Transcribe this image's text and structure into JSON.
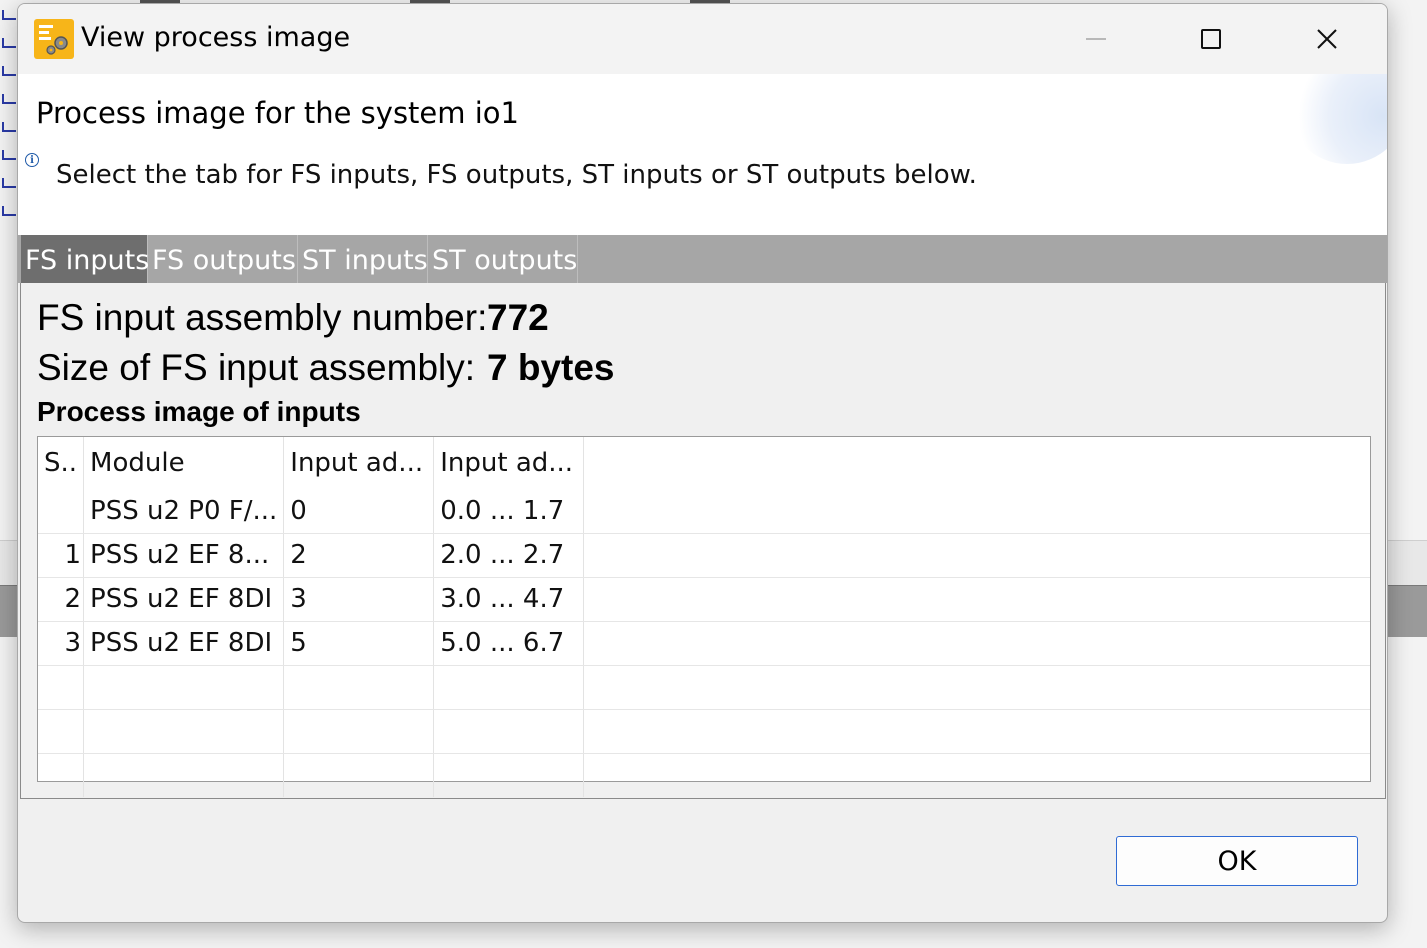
{
  "window": {
    "title": "View process image",
    "icon": "gear-app-icon",
    "controls": [
      "minimize-icon",
      "maximize-icon",
      "close-icon"
    ]
  },
  "header": {
    "title": "Process image for the system io1",
    "message": "Select the tab for FS inputs, FS outputs, ST inputs or ST outputs below.",
    "info_icon": "info-icon"
  },
  "tabs": [
    {
      "label": "FS inputs",
      "active": true
    },
    {
      "label": "FS outputs",
      "active": false
    },
    {
      "label": "ST inputs",
      "active": false
    },
    {
      "label": "ST outputs",
      "active": false
    }
  ],
  "content": {
    "assembly_number_label": "FS input assembly number:",
    "assembly_number_value": "772",
    "assembly_size_label": "Size of FS input assembly:",
    "assembly_size_value": "7 bytes",
    "section_title": "Process image of inputs"
  },
  "table": {
    "headers": [
      "S..",
      "Module",
      "Input ad...",
      "Input ad..."
    ],
    "rows": [
      {
        "slot": "",
        "module": "PSS u2 P0 F/...",
        "byte_address": "0",
        "bit_range": "0.0 ... 1.7"
      },
      {
        "slot": "1",
        "module": "PSS u2 EF 8...",
        "byte_address": "2",
        "bit_range": "2.0 ... 2.7"
      },
      {
        "slot": "2",
        "module": "PSS u2 EF 8DI",
        "byte_address": "3",
        "bit_range": "3.0 ... 4.7"
      },
      {
        "slot": "3",
        "module": "PSS u2 EF 8DI",
        "byte_address": "5",
        "bit_range": "5.0 ... 6.7"
      }
    ]
  },
  "footer": {
    "ok_label": "OK"
  },
  "colors": {
    "tab_strip": "#a6a6a6",
    "active_tab": "#6e6e6e",
    "accent": "#2f6bd4",
    "app_icon": "#f7b519"
  }
}
